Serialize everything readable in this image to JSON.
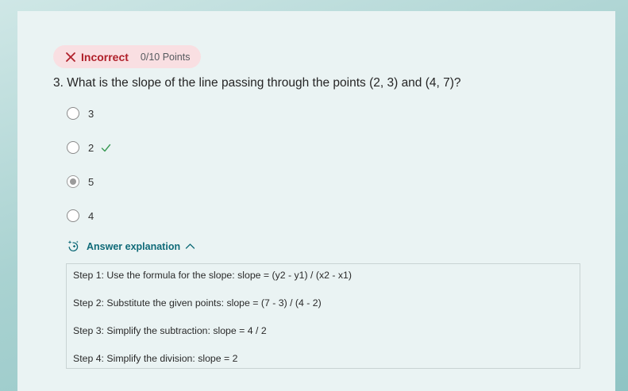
{
  "status": {
    "label": "Incorrect",
    "points": "0/10 Points"
  },
  "question": {
    "text": "3. What is the slope of the line passing through the points (2, 3) and (4, 7)?"
  },
  "options": [
    {
      "label": "3",
      "selected": false,
      "correct": false
    },
    {
      "label": "2",
      "selected": false,
      "correct": true
    },
    {
      "label": "5",
      "selected": true,
      "correct": false
    },
    {
      "label": "4",
      "selected": false,
      "correct": false
    }
  ],
  "explanation": {
    "toggle_label": "Answer explanation",
    "expanded": true,
    "steps": [
      "Step 1: Use the formula for the slope: slope = (y2 - y1) / (x2 - x1)",
      "Step 2: Substitute the given points: slope = (7 - 3) / (4 - 2)",
      "Step 3: Simplify the subtraction: slope = 4 / 2",
      "Step 4: Simplify the division: slope = 2"
    ]
  },
  "icons": {
    "status": "close-icon",
    "correct": "checkmark-icon",
    "explanation": "sparkle-icon",
    "toggle": "chevron-up-icon"
  },
  "colors": {
    "incorrect": "#b0202a",
    "incorrect_bg": "#f9dfe2",
    "correct_check": "#3a9a55",
    "accent": "#0f6a78"
  }
}
